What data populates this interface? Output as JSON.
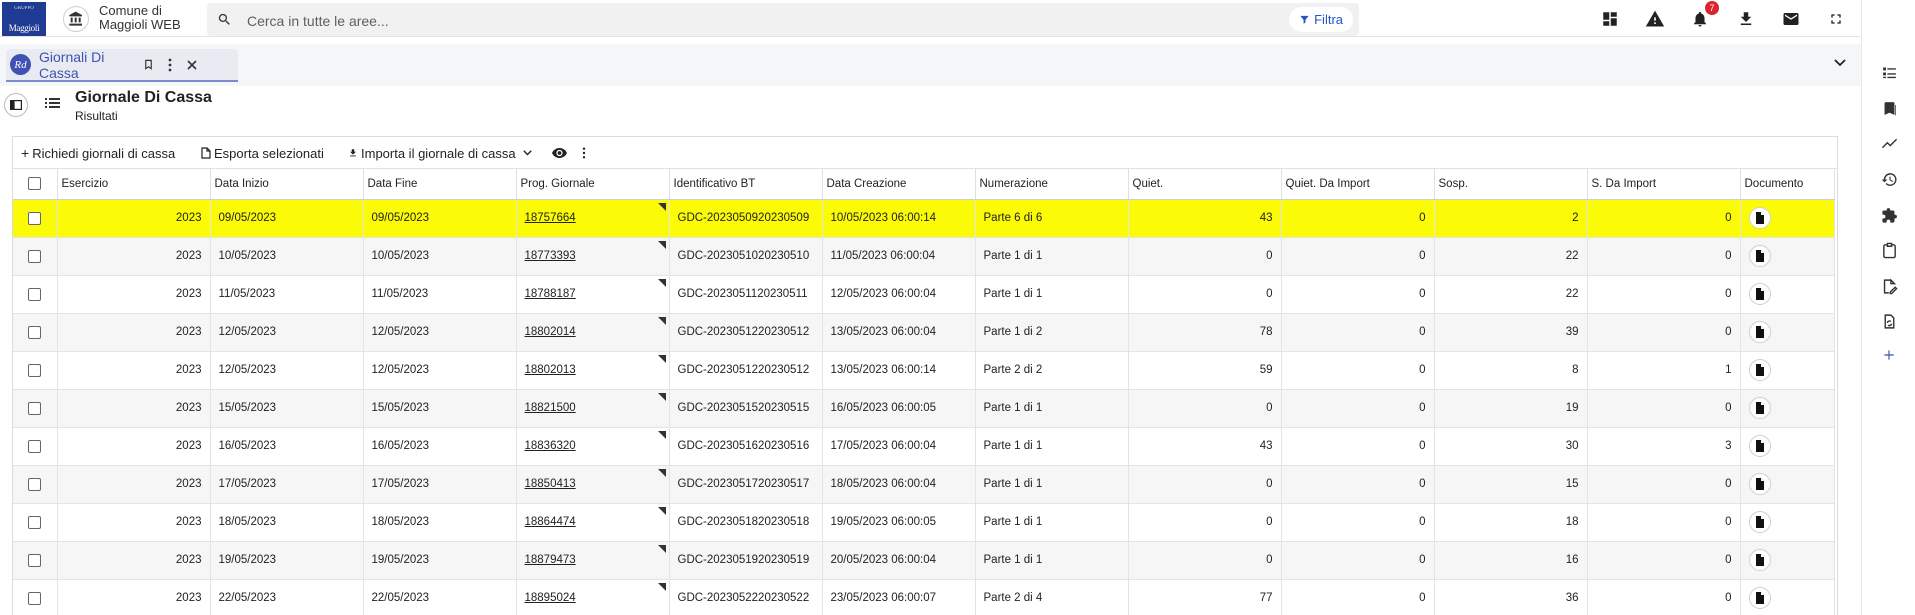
{
  "header": {
    "logo_top_text": "GRUPPO",
    "logo_text": "Maggioli",
    "app_title_line1": "Comune di",
    "app_title_line2": "Maggioli WEB",
    "search_placeholder": "Cerca in tutte le aree...",
    "filter_label": "Filtra",
    "notification_count": "7"
  },
  "tabs": [
    {
      "icon_text": "Rd",
      "label": "Giornali Di Cassa"
    }
  ],
  "page": {
    "title": "Giornale Di Cassa",
    "subtitle": "Risultati"
  },
  "toolbar": {
    "request_label": "Richiedi giornali di cassa",
    "export_label": "Esporta selezionati",
    "import_label": "Importa il giornale di cassa"
  },
  "table": {
    "columns": [
      "Esercizio",
      "Data Inizio",
      "Data Fine",
      "Prog. Giornale",
      "Identificativo BT",
      "Data Creazione",
      "Numerazione",
      "Quiet.",
      "Quiet. Da Import",
      "Sosp.",
      "S. Da Import",
      "Documento"
    ],
    "rows": [
      {
        "esercizio": "2023",
        "data_inizio": "09/05/2023",
        "data_fine": "09/05/2023",
        "prog": "18757664",
        "bt": "GDC-2023050920230509",
        "creazione": "10/05/2023 06:00:14",
        "numerazione": "Parte 6 di 6",
        "quiet": "43",
        "quiet_import": "0",
        "sosp": "2",
        "s_import": "0",
        "selected": true
      },
      {
        "esercizio": "2023",
        "data_inizio": "10/05/2023",
        "data_fine": "10/05/2023",
        "prog": "18773393",
        "bt": "GDC-2023051020230510",
        "creazione": "11/05/2023 06:00:04",
        "numerazione": "Parte 1 di 1",
        "quiet": "0",
        "quiet_import": "0",
        "sosp": "22",
        "s_import": "0"
      },
      {
        "esercizio": "2023",
        "data_inizio": "11/05/2023",
        "data_fine": "11/05/2023",
        "prog": "18788187",
        "bt": "GDC-2023051120230511",
        "creazione": "12/05/2023 06:00:04",
        "numerazione": "Parte 1 di 1",
        "quiet": "0",
        "quiet_import": "0",
        "sosp": "22",
        "s_import": "0"
      },
      {
        "esercizio": "2023",
        "data_inizio": "12/05/2023",
        "data_fine": "12/05/2023",
        "prog": "18802014",
        "bt": "GDC-2023051220230512",
        "creazione": "13/05/2023 06:00:04",
        "numerazione": "Parte 1 di 2",
        "quiet": "78",
        "quiet_import": "0",
        "sosp": "39",
        "s_import": "0"
      },
      {
        "esercizio": "2023",
        "data_inizio": "12/05/2023",
        "data_fine": "12/05/2023",
        "prog": "18802013",
        "bt": "GDC-2023051220230512",
        "creazione": "13/05/2023 06:00:14",
        "numerazione": "Parte 2 di 2",
        "quiet": "59",
        "quiet_import": "0",
        "sosp": "8",
        "s_import": "1"
      },
      {
        "esercizio": "2023",
        "data_inizio": "15/05/2023",
        "data_fine": "15/05/2023",
        "prog": "18821500",
        "bt": "GDC-2023051520230515",
        "creazione": "16/05/2023 06:00:05",
        "numerazione": "Parte 1 di 1",
        "quiet": "0",
        "quiet_import": "0",
        "sosp": "19",
        "s_import": "0"
      },
      {
        "esercizio": "2023",
        "data_inizio": "16/05/2023",
        "data_fine": "16/05/2023",
        "prog": "18836320",
        "bt": "GDC-2023051620230516",
        "creazione": "17/05/2023 06:00:04",
        "numerazione": "Parte 1 di 1",
        "quiet": "43",
        "quiet_import": "0",
        "sosp": "30",
        "s_import": "3"
      },
      {
        "esercizio": "2023",
        "data_inizio": "17/05/2023",
        "data_fine": "17/05/2023",
        "prog": "18850413",
        "bt": "GDC-2023051720230517",
        "creazione": "18/05/2023 06:00:04",
        "numerazione": "Parte 1 di 1",
        "quiet": "0",
        "quiet_import": "0",
        "sosp": "15",
        "s_import": "0"
      },
      {
        "esercizio": "2023",
        "data_inizio": "18/05/2023",
        "data_fine": "18/05/2023",
        "prog": "18864474",
        "bt": "GDC-2023051820230518",
        "creazione": "19/05/2023 06:00:05",
        "numerazione": "Parte 1 di 1",
        "quiet": "0",
        "quiet_import": "0",
        "sosp": "18",
        "s_import": "0"
      },
      {
        "esercizio": "2023",
        "data_inizio": "19/05/2023",
        "data_fine": "19/05/2023",
        "prog": "18879473",
        "bt": "GDC-2023051920230519",
        "creazione": "20/05/2023 06:00:04",
        "numerazione": "Parte 1 di 1",
        "quiet": "0",
        "quiet_import": "0",
        "sosp": "16",
        "s_import": "0"
      },
      {
        "esercizio": "2023",
        "data_inizio": "22/05/2023",
        "data_fine": "22/05/2023",
        "prog": "18895024",
        "bt": "GDC-2023052220230522",
        "creazione": "23/05/2023 06:00:07",
        "numerazione": "Parte 2 di 4",
        "quiet": "77",
        "quiet_import": "0",
        "sosp": "36",
        "s_import": "0"
      }
    ]
  },
  "colors": {
    "accent": "#3f51b5",
    "selected_row": "#fbfb08",
    "badge": "#d9262d",
    "filter_text": "#2456c7"
  },
  "icons": {
    "topbar": [
      "dashboard-icon",
      "warning-icon",
      "notifications-icon",
      "download-icon",
      "mail-icon",
      "fullscreen-icon",
      "account-icon"
    ],
    "rail": [
      "task-list-icon",
      "bookmark-icon",
      "trending-icon",
      "history-icon",
      "extension-icon",
      "clipboard-icon",
      "edit-document-icon",
      "document-sync-icon",
      "add-icon"
    ]
  }
}
